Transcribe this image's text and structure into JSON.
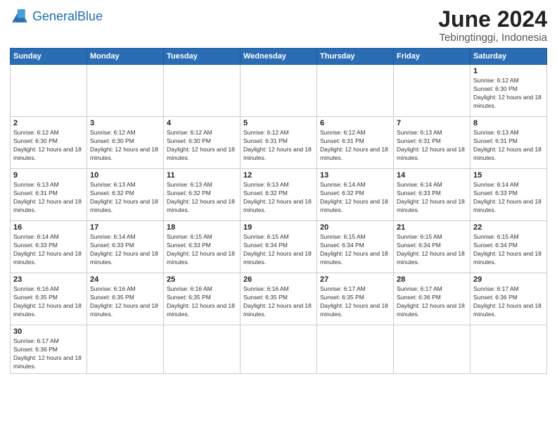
{
  "header": {
    "logo_general": "General",
    "logo_blue": "Blue",
    "title": "June 2024",
    "subtitle": "Tebingtinggi, Indonesia"
  },
  "days_of_week": [
    "Sunday",
    "Monday",
    "Tuesday",
    "Wednesday",
    "Thursday",
    "Friday",
    "Saturday"
  ],
  "weeks": [
    [
      {
        "day": "",
        "info": ""
      },
      {
        "day": "",
        "info": ""
      },
      {
        "day": "",
        "info": ""
      },
      {
        "day": "",
        "info": ""
      },
      {
        "day": "",
        "info": ""
      },
      {
        "day": "",
        "info": ""
      },
      {
        "day": "1",
        "info": "Sunrise: 6:12 AM\nSunset: 6:30 PM\nDaylight: 12 hours and 18 minutes."
      }
    ],
    [
      {
        "day": "2",
        "info": "Sunrise: 6:12 AM\nSunset: 6:30 PM\nDaylight: 12 hours and 18 minutes."
      },
      {
        "day": "3",
        "info": "Sunrise: 6:12 AM\nSunset: 6:30 PM\nDaylight: 12 hours and 18 minutes."
      },
      {
        "day": "4",
        "info": "Sunrise: 6:12 AM\nSunset: 6:30 PM\nDaylight: 12 hours and 18 minutes."
      },
      {
        "day": "5",
        "info": "Sunrise: 6:12 AM\nSunset: 6:31 PM\nDaylight: 12 hours and 18 minutes."
      },
      {
        "day": "6",
        "info": "Sunrise: 6:12 AM\nSunset: 6:31 PM\nDaylight: 12 hours and 18 minutes."
      },
      {
        "day": "7",
        "info": "Sunrise: 6:13 AM\nSunset: 6:31 PM\nDaylight: 12 hours and 18 minutes."
      },
      {
        "day": "8",
        "info": "Sunrise: 6:13 AM\nSunset: 6:31 PM\nDaylight: 12 hours and 18 minutes."
      }
    ],
    [
      {
        "day": "9",
        "info": "Sunrise: 6:13 AM\nSunset: 6:31 PM\nDaylight: 12 hours and 18 minutes."
      },
      {
        "day": "10",
        "info": "Sunrise: 6:13 AM\nSunset: 6:32 PM\nDaylight: 12 hours and 18 minutes."
      },
      {
        "day": "11",
        "info": "Sunrise: 6:13 AM\nSunset: 6:32 PM\nDaylight: 12 hours and 18 minutes."
      },
      {
        "day": "12",
        "info": "Sunrise: 6:13 AM\nSunset: 6:32 PM\nDaylight: 12 hours and 18 minutes."
      },
      {
        "day": "13",
        "info": "Sunrise: 6:14 AM\nSunset: 6:32 PM\nDaylight: 12 hours and 18 minutes."
      },
      {
        "day": "14",
        "info": "Sunrise: 6:14 AM\nSunset: 6:33 PM\nDaylight: 12 hours and 18 minutes."
      },
      {
        "day": "15",
        "info": "Sunrise: 6:14 AM\nSunset: 6:33 PM\nDaylight: 12 hours and 18 minutes."
      }
    ],
    [
      {
        "day": "16",
        "info": "Sunrise: 6:14 AM\nSunset: 6:33 PM\nDaylight: 12 hours and 18 minutes."
      },
      {
        "day": "17",
        "info": "Sunrise: 6:14 AM\nSunset: 6:33 PM\nDaylight: 12 hours and 18 minutes."
      },
      {
        "day": "18",
        "info": "Sunrise: 6:15 AM\nSunset: 6:33 PM\nDaylight: 12 hours and 18 minutes."
      },
      {
        "day": "19",
        "info": "Sunrise: 6:15 AM\nSunset: 6:34 PM\nDaylight: 12 hours and 18 minutes."
      },
      {
        "day": "20",
        "info": "Sunrise: 6:15 AM\nSunset: 6:34 PM\nDaylight: 12 hours and 18 minutes."
      },
      {
        "day": "21",
        "info": "Sunrise: 6:15 AM\nSunset: 6:34 PM\nDaylight: 12 hours and 18 minutes."
      },
      {
        "day": "22",
        "info": "Sunrise: 6:15 AM\nSunset: 6:34 PM\nDaylight: 12 hours and 18 minutes."
      }
    ],
    [
      {
        "day": "23",
        "info": "Sunrise: 6:16 AM\nSunset: 6:35 PM\nDaylight: 12 hours and 18 minutes."
      },
      {
        "day": "24",
        "info": "Sunrise: 6:16 AM\nSunset: 6:35 PM\nDaylight: 12 hours and 18 minutes."
      },
      {
        "day": "25",
        "info": "Sunrise: 6:16 AM\nSunset: 6:35 PM\nDaylight: 12 hours and 18 minutes."
      },
      {
        "day": "26",
        "info": "Sunrise: 6:16 AM\nSunset: 6:35 PM\nDaylight: 12 hours and 18 minutes."
      },
      {
        "day": "27",
        "info": "Sunrise: 6:17 AM\nSunset: 6:35 PM\nDaylight: 12 hours and 18 minutes."
      },
      {
        "day": "28",
        "info": "Sunrise: 6:17 AM\nSunset: 6:36 PM\nDaylight: 12 hours and 18 minutes."
      },
      {
        "day": "29",
        "info": "Sunrise: 6:17 AM\nSunset: 6:36 PM\nDaylight: 12 hours and 18 minutes."
      }
    ],
    [
      {
        "day": "30",
        "info": "Sunrise: 6:17 AM\nSunset: 6:36 PM\nDaylight: 12 hours and 18 minutes."
      },
      {
        "day": "",
        "info": ""
      },
      {
        "day": "",
        "info": ""
      },
      {
        "day": "",
        "info": ""
      },
      {
        "day": "",
        "info": ""
      },
      {
        "day": "",
        "info": ""
      },
      {
        "day": "",
        "info": ""
      }
    ]
  ]
}
